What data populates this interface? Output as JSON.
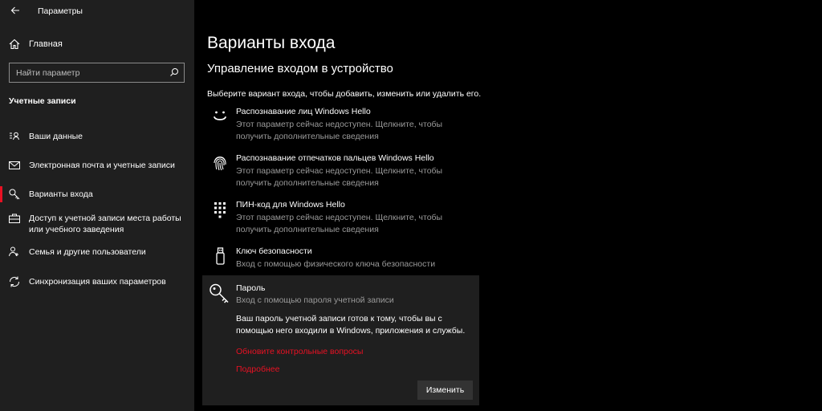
{
  "window": {
    "title": "Параметры"
  },
  "sidebar": {
    "home_label": "Главная",
    "search": {
      "placeholder": "Найти параметр"
    },
    "section_header": "Учетные записи",
    "items": [
      {
        "label": "Ваши данные",
        "icon": "user-info-icon"
      },
      {
        "label": "Электронная почта и учетные записи",
        "icon": "mail-icon"
      },
      {
        "label": "Варианты входа",
        "icon": "key-icon",
        "active": true
      },
      {
        "label": "Доступ к учетной записи места работы или учебного заведения",
        "icon": "briefcase-icon"
      },
      {
        "label": "Семья и другие пользователи",
        "icon": "family-icon"
      },
      {
        "label": "Синхронизация ваших параметров",
        "icon": "sync-icon"
      }
    ]
  },
  "main": {
    "title": "Варианты входа",
    "subtitle": "Управление входом в устройство",
    "instruction": "Выберите вариант входа, чтобы добавить, изменить или удалить его.",
    "options": [
      {
        "title": "Распознавание лиц Windows Hello",
        "description": "Этот параметр сейчас недоступен. Щелкните, чтобы получить дополнительные сведения",
        "icon": "face-icon"
      },
      {
        "title": "Распознавание отпечатков пальцев Windows Hello",
        "description": "Этот параметр сейчас недоступен. Щелкните, чтобы получить дополнительные сведения",
        "icon": "fingerprint-icon"
      },
      {
        "title": "ПИН-код для Windows Hello",
        "description": "Этот параметр сейчас недоступен. Щелкните, чтобы получить дополнительные сведения",
        "icon": "pin-keypad-icon"
      },
      {
        "title": "Ключ безопасности",
        "description": "Вход с помощью физического ключа безопасности",
        "icon": "usb-key-icon"
      }
    ],
    "password": {
      "title": "Пароль",
      "description": "Вход с помощью пароля учетной записи",
      "info": "Ваш пароль учетной записи готов к тому, чтобы вы с помощью него входили в Windows, приложения и службы.",
      "link_questions": "Обновите контрольные вопросы",
      "link_more": "Подробнее",
      "change_button": "Изменить",
      "icon": "password-key-icon"
    }
  },
  "colors": {
    "accent": "#e81123",
    "sidebar_bg": "#1f1f1f",
    "main_bg": "#000000"
  }
}
